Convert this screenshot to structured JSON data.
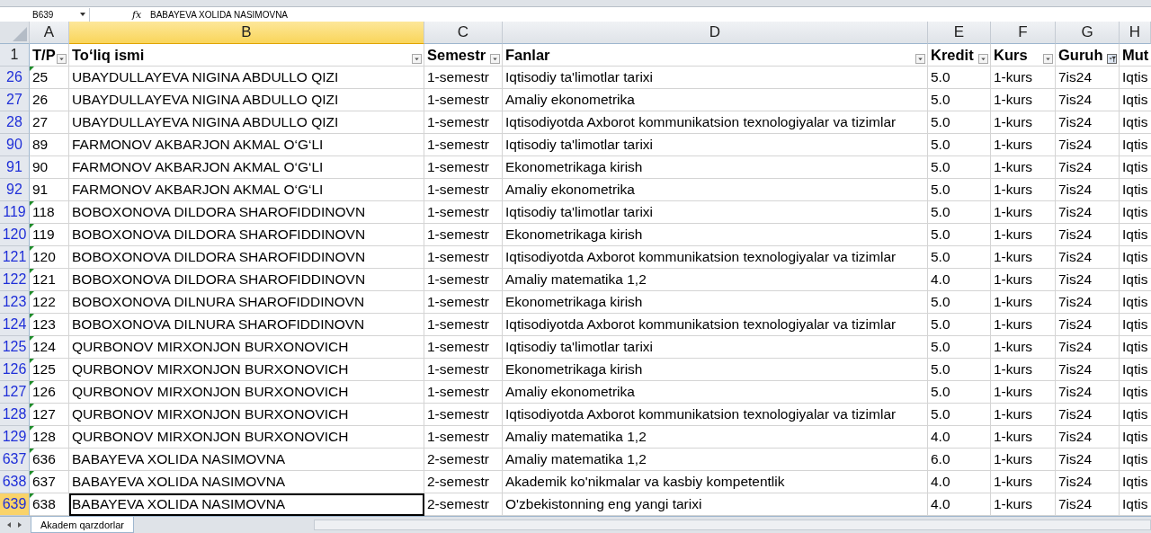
{
  "formula_bar": {
    "name_box": "B639",
    "fx": "fx",
    "formula": "BABAYEVA XOLIDA NASIMOVNA"
  },
  "columns": [
    {
      "label": "A",
      "selected": false
    },
    {
      "label": "B",
      "selected": true
    },
    {
      "label": "C",
      "selected": false
    },
    {
      "label": "D",
      "selected": false
    },
    {
      "label": "E",
      "selected": false
    },
    {
      "label": "F",
      "selected": false
    },
    {
      "label": "G",
      "selected": false
    },
    {
      "label": "H",
      "selected": false
    }
  ],
  "header_row": {
    "number": "1",
    "cells": [
      {
        "text": "T/P",
        "filter_button": true,
        "filter_active": false
      },
      {
        "text": "To‘liq ismi",
        "filter_button": true,
        "filter_active": false
      },
      {
        "text": "Semestr",
        "filter_button": true,
        "filter_active": false
      },
      {
        "text": "Fanlar",
        "filter_button": true,
        "filter_active": false
      },
      {
        "text": "Kredit",
        "filter_button": true,
        "filter_active": false
      },
      {
        "text": "Kurs",
        "filter_button": true,
        "filter_active": false
      },
      {
        "text": "Guruh",
        "filter_button": true,
        "filter_active": true
      },
      {
        "text": "Mut",
        "filter_button": false
      }
    ]
  },
  "rows": [
    {
      "number": "26",
      "selected": false,
      "flag": true,
      "cells": [
        "25",
        "UBAYDULLAYEVA NIGINA ABDULLO QIZI",
        "1-semestr",
        "Iqtisodiy ta'limotlar tarixi",
        "5.0",
        "1-kurs",
        "7is24",
        "Iqtis"
      ]
    },
    {
      "number": "27",
      "selected": false,
      "flag": false,
      "cells": [
        "26",
        "UBAYDULLAYEVA NIGINA ABDULLO QIZI",
        "1-semestr",
        "Amaliy ekonometrika",
        "5.0",
        "1-kurs",
        "7is24",
        "Iqtis"
      ]
    },
    {
      "number": "28",
      "selected": false,
      "flag": false,
      "cells": [
        "27",
        "UBAYDULLAYEVA NIGINA ABDULLO QIZI",
        "1-semestr",
        "Iqtisodiyotda Axborot kommunikatsion texnologiyalar va tizimlar",
        "5.0",
        "1-kurs",
        "7is24",
        "Iqtis"
      ]
    },
    {
      "number": "90",
      "selected": false,
      "flag": false,
      "cells": [
        "89",
        "FARMONOV AKBARJON AKMAL O‘G‘LI",
        "1-semestr",
        "Iqtisodiy ta'limotlar tarixi",
        "5.0",
        "1-kurs",
        "7is24",
        "Iqtis"
      ]
    },
    {
      "number": "91",
      "selected": false,
      "flag": false,
      "cells": [
        "90",
        "FARMONOV AKBARJON AKMAL O‘G‘LI",
        "1-semestr",
        "Ekonometrikaga kirish",
        "5.0",
        "1-kurs",
        "7is24",
        "Iqtis"
      ]
    },
    {
      "number": "92",
      "selected": false,
      "flag": false,
      "cells": [
        "91",
        "FARMONOV AKBARJON AKMAL O‘G‘LI",
        "1-semestr",
        "Amaliy ekonometrika",
        "5.0",
        "1-kurs",
        "7is24",
        "Iqtis"
      ]
    },
    {
      "number": "119",
      "selected": false,
      "flag": true,
      "cells": [
        "118",
        "BOBOXONOVA DILDORA SHAROFIDDINOVN",
        "1-semestr",
        "Iqtisodiy ta'limotlar tarixi",
        "5.0",
        "1-kurs",
        "7is24",
        "Iqtis"
      ]
    },
    {
      "number": "120",
      "selected": false,
      "flag": true,
      "cells": [
        "119",
        "BOBOXONOVA DILDORA SHAROFIDDINOVN",
        "1-semestr",
        "Ekonometrikaga kirish",
        "5.0",
        "1-kurs",
        "7is24",
        "Iqtis"
      ]
    },
    {
      "number": "121",
      "selected": false,
      "flag": true,
      "cells": [
        "120",
        "BOBOXONOVA DILDORA SHAROFIDDINOVN",
        "1-semestr",
        "Iqtisodiyotda Axborot kommunikatsion texnologiyalar va tizimlar",
        "5.0",
        "1-kurs",
        "7is24",
        "Iqtis"
      ]
    },
    {
      "number": "122",
      "selected": false,
      "flag": true,
      "cells": [
        "121",
        "BOBOXONOVA DILDORA SHAROFIDDINOVN",
        "1-semestr",
        "Amaliy matematika 1,2",
        "4.0",
        "1-kurs",
        "7is24",
        "Iqtis"
      ]
    },
    {
      "number": "123",
      "selected": false,
      "flag": true,
      "cells": [
        "122",
        "BOBOXONOVA DILNURA SHAROFIDDINOVN",
        "1-semestr",
        "Ekonometrikaga kirish",
        "5.0",
        "1-kurs",
        "7is24",
        "Iqtis"
      ]
    },
    {
      "number": "124",
      "selected": false,
      "flag": true,
      "cells": [
        "123",
        "BOBOXONOVA DILNURA SHAROFIDDINOVN",
        "1-semestr",
        "Iqtisodiyotda Axborot kommunikatsion texnologiyalar va tizimlar",
        "5.0",
        "1-kurs",
        "7is24",
        "Iqtis"
      ]
    },
    {
      "number": "125",
      "selected": false,
      "flag": true,
      "cells": [
        "124",
        "QURBONOV MIRXONJON BURXONOVICH",
        "1-semestr",
        "Iqtisodiy ta'limotlar tarixi",
        "5.0",
        "1-kurs",
        "7is24",
        "Iqtis"
      ]
    },
    {
      "number": "126",
      "selected": false,
      "flag": true,
      "cells": [
        "125",
        "QURBONOV MIRXONJON BURXONOVICH",
        "1-semestr",
        "Ekonometrikaga kirish",
        "5.0",
        "1-kurs",
        "7is24",
        "Iqtis"
      ]
    },
    {
      "number": "127",
      "selected": false,
      "flag": true,
      "cells": [
        "126",
        "QURBONOV MIRXONJON BURXONOVICH",
        "1-semestr",
        "Amaliy ekonometrika",
        "5.0",
        "1-kurs",
        "7is24",
        "Iqtis"
      ]
    },
    {
      "number": "128",
      "selected": false,
      "flag": true,
      "cells": [
        "127",
        "QURBONOV MIRXONJON BURXONOVICH",
        "1-semestr",
        "Iqtisodiyotda Axborot kommunikatsion texnologiyalar va tizimlar",
        "5.0",
        "1-kurs",
        "7is24",
        "Iqtis"
      ]
    },
    {
      "number": "129",
      "selected": false,
      "flag": true,
      "cells": [
        "128",
        "QURBONOV MIRXONJON BURXONOVICH",
        "1-semestr",
        "Amaliy matematika 1,2",
        "4.0",
        "1-kurs",
        "7is24",
        "Iqtis"
      ]
    },
    {
      "number": "637",
      "selected": false,
      "flag": true,
      "cells": [
        "636",
        "BABAYEVA XOLIDA NASIMOVNA",
        "2-semestr",
        "Amaliy matematika 1,2",
        "6.0",
        "1-kurs",
        "7is24",
        "Iqtis"
      ]
    },
    {
      "number": "638",
      "selected": false,
      "flag": true,
      "cells": [
        "637",
        "BABAYEVA XOLIDA NASIMOVNA",
        "2-semestr",
        "Akademik ko'nikmalar va kasbiy kompetentlik",
        "4.0",
        "1-kurs",
        "7is24",
        "Iqtis"
      ]
    },
    {
      "number": "639",
      "selected": true,
      "flag": true,
      "cells": [
        "638",
        "BABAYEVA XOLIDA NASIMOVNA",
        "2-semestr",
        "O'zbekistonning eng yangi tarixi",
        "4.0",
        "1-kurs",
        "7is24",
        "Iqtis"
      ]
    }
  ],
  "sheet_tabs": [
    {
      "label": "Akadem qarzdorlar",
      "selected": true
    }
  ]
}
